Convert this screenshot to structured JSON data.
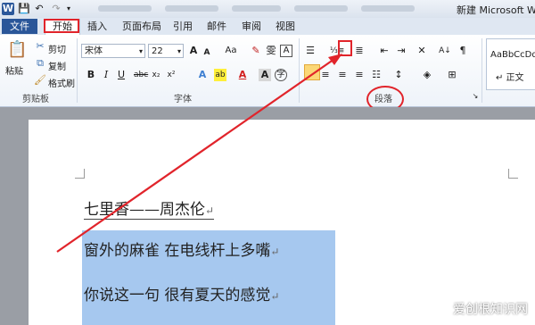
{
  "titlebar": {
    "title": "新建 Microsoft Wo",
    "logo": "W"
  },
  "tabs": [
    "文件",
    "开始",
    "插入",
    "页面布局",
    "引用",
    "邮件",
    "审阅",
    "视图"
  ],
  "clipboard": {
    "paste": "粘贴",
    "cut": "剪切",
    "copy": "复制",
    "format_painter": "格式刷",
    "group": "剪贴板"
  },
  "font": {
    "name": "宋体",
    "size": "22",
    "group": "字体"
  },
  "paragraph": {
    "group": "段落"
  },
  "styles": {
    "preview": "AaBbCcDd",
    "normal": "↵ 正文"
  },
  "document": {
    "title_line": "七里香——周杰伦",
    "lines": [
      "窗外的麻雀  在电线杆上多嘴",
      "你说这一句  很有夏天的感觉"
    ]
  },
  "watermark": "爱创根知识网",
  "colors": {
    "accent": "#2a5699",
    "highlight_red": "#e1242b",
    "selection": "#a6c8ef"
  }
}
